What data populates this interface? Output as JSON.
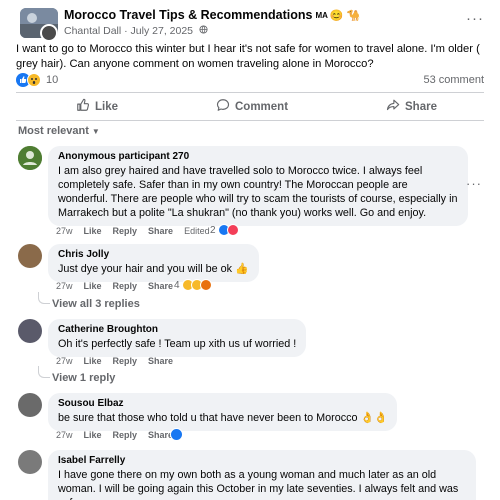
{
  "post": {
    "group_name": "Morocco Travel Tips & Recommendations",
    "group_badge": "MA",
    "group_emojis": "😊 🐪",
    "author": "Chantal Dall",
    "date": "July 27, 2025",
    "separator": "·",
    "text": "I want to go to Morocco this winter but I hear it's not safe for women to travel alone. I'm older ( grey hair).  Can anyone comment on women traveling alone in Morocco?",
    "reaction_count": "10",
    "comment_count": "53 comment"
  },
  "actions": {
    "like": "Like",
    "comment": "Comment",
    "share": "Share"
  },
  "sort": {
    "label": "Most relevant",
    "caret": "▼"
  },
  "labels": {
    "like": "Like",
    "reply": "Reply",
    "share": "Share",
    "edited": "Edited"
  },
  "comments": [
    {
      "name": "Anonymous participant 270",
      "text": "I am also grey haired and have travelled solo to Morocco twice. I always feel completely safe. Safer than in my own country! The Moroccan people are wonderful. There are people who will try to scam the tourists of course, especially in Marrakech but a polite \"La shukran\" (no thank you) works well. Go and enjoy.",
      "time": "27w",
      "reactions": "2",
      "avatar_color": "#5b8c3a"
    },
    {
      "name": "Chris Jolly",
      "text": "Just dye your hair and you will be ok 👍",
      "time": "27w",
      "reactions": "4",
      "avatar_color": "#8a6a4a"
    },
    {
      "name": "Catherine Broughton",
      "text": "Oh it's perfectly safe ! Team up xith us uf worried !",
      "time": "27w",
      "avatar_color": "#5a5a6a"
    },
    {
      "name": "Sousou Elbaz",
      "text": "be sure that those who told u that have never been to Morocco 👌👌",
      "time": "27w",
      "avatar_color": "#6a6a6a"
    },
    {
      "name": "Isabel Farrelly",
      "text": "I have gone there on my own both as a young woman and much later as an old woman. I will be going again this October in my late seventies. I always felt and was safe.",
      "avatar_color": "#7a7a7a"
    }
  ],
  "replies": {
    "chris": "View all 3 replies",
    "catherine": "View 1 reply"
  },
  "more_glyph": "···",
  "colors": {
    "like_blue": "#1877f2",
    "wow_yellow": "#f7b928",
    "love_red": "#f33e58",
    "bubble_gray": "#f0f2f5",
    "secondary_text": "#65676b"
  }
}
